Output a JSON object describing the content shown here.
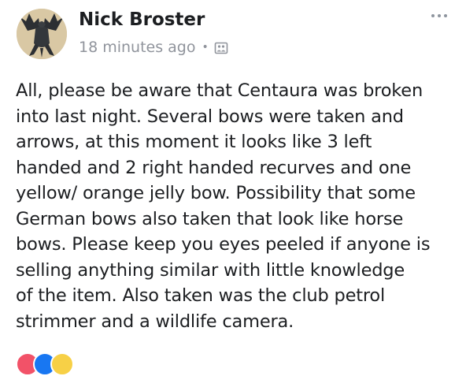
{
  "post": {
    "author": "Nick Broster",
    "timestamp": "18 minutes ago",
    "separator": "•",
    "audience_icon": "group-photo-icon",
    "avatar_icon": "dragon-avatar",
    "menu_icon": "more-options-icon",
    "text_lines": [
      "All, please be aware that Centaura was broken",
      "into last night. Several bows were taken and",
      "arrows, at this moment it looks like 3 left",
      "handed and 2 right handed recurves and one",
      "yellow/ orange jelly bow. Possibility that some",
      "German bows also taken that look like horse",
      "bows. Please keep you eyes peeled if anyone is",
      "selling anything similar with little knowledge",
      "of the item. Also taken was the club petrol",
      "strimmer and a wildlife camera."
    ],
    "reactions": [
      "love-reaction-icon",
      "like-reaction-icon",
      "haha-reaction-icon"
    ]
  },
  "colors": {
    "text": "#1c1e21",
    "meta": "#90949c",
    "accent": "#1877f2"
  }
}
